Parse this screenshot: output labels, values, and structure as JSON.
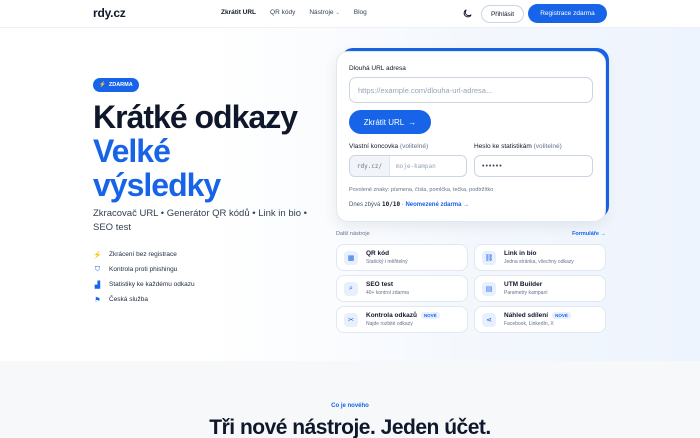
{
  "nav": {
    "logo": "rdy.cz",
    "links": [
      "Zkrátit URL",
      "QR kódy",
      "Nástroje",
      "Blog"
    ],
    "login": "Přihlásit",
    "signup": "Registrace zdarma"
  },
  "hero": {
    "badge": "ZDARMA",
    "title_line1": "Krátké odkazy",
    "title_line2": "Velké",
    "title_line3": "výsledky",
    "subtitle": "Zkracovač URL • Generátor QR kódů • Link in bio • SEO test",
    "features": [
      "Zkrácení bez registrace",
      "Kontrola proti phishingu",
      "Statistiky ke každému odkazu",
      "Česká služba"
    ]
  },
  "form": {
    "url_label": "Dlouhá URL adresa",
    "url_placeholder": "https://example.com/dlouha-url-adresa...",
    "shorten_button": "Zkrátit URL",
    "suffix_label": "Vlastní koncovka",
    "suffix_optional": "(volitelné)",
    "suffix_prefix": "rdy.cz/",
    "suffix_placeholder": "moje-kampan",
    "password_label": "Heslo ke statistikám",
    "password_optional": "(volitelné)",
    "password_value": "••••••",
    "hint": "Povolené znaky: písmena, čísla, pomlčka, tečka, podtržítko",
    "remaining_prefix": "Dnes zbývá",
    "remaining_count": "10/10",
    "remaining_link": "Neomezené zdarma →"
  },
  "tools": {
    "heading": "Další nástroje",
    "more_link": "Formuláře →",
    "items": [
      {
        "title": "QR kód",
        "desc": "Statický i měřitelný",
        "icon": "qr-icon",
        "new": ""
      },
      {
        "title": "Link in bio",
        "desc": "Jedna stránka, všechny odkazy",
        "icon": "link-icon",
        "new": ""
      },
      {
        "title": "SEO test",
        "desc": "40+ kontrol zdarma",
        "icon": "search-icon",
        "new": ""
      },
      {
        "title": "UTM Builder",
        "desc": "Parametry kampaní",
        "icon": "utm-icon",
        "new": ""
      },
      {
        "title": "Kontrola odkazů",
        "desc": "Najde rozbité odkazy",
        "icon": "broken-link-icon",
        "new": "NOVÉ"
      },
      {
        "title": "Náhled sdílení",
        "desc": "Facebook, LinkedIn, X",
        "icon": "share-icon",
        "new": "NOVÉ"
      }
    ]
  },
  "section": {
    "kicker": "Co je nového",
    "title": "Tři nové nástroje. Jeden účet."
  },
  "colors": {
    "accent": "#1764e8",
    "text": "#0f172a",
    "muted": "#64748b"
  }
}
